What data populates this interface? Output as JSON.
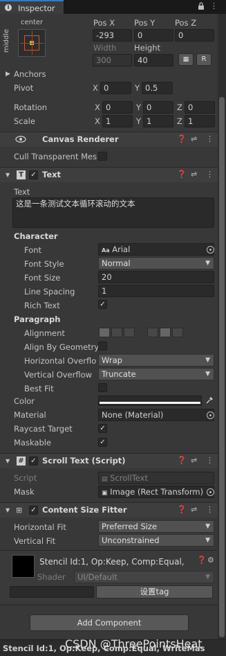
{
  "tab": {
    "title": "Inspector"
  },
  "rect_transform": {
    "anchor_preset": {
      "horizontal": "center",
      "vertical": "middle"
    },
    "pos_x_label": "Pos X",
    "pos_y_label": "Pos Y",
    "pos_z_label": "Pos Z",
    "pos_x": "-293",
    "pos_y": "0",
    "pos_z": "0",
    "width_label": "Width",
    "height_label": "Height",
    "width": "300",
    "height": "40",
    "r_button": "R",
    "anchors_label": "Anchors",
    "pivot_label": "Pivot",
    "pivot_x": "0",
    "pivot_y": "0.5",
    "rotation_label": "Rotation",
    "rot_x": "0",
    "rot_y": "0",
    "rot_z": "0",
    "scale_label": "Scale",
    "scale_x": "1",
    "scale_y": "1",
    "scale_z": "1",
    "axis_x": "X",
    "axis_y": "Y",
    "axis_z": "Z"
  },
  "canvas_renderer": {
    "title": "Canvas Renderer",
    "cull_label": "Cull Transparent Mes"
  },
  "text": {
    "title": "Text",
    "text_label": "Text",
    "text_value": "这是一条测试文本循环滚动的文本",
    "character_label": "Character",
    "font_label": "Font",
    "font_value": "Arial",
    "font_prefix": "Aa",
    "font_style_label": "Font Style",
    "font_style_value": "Normal",
    "font_size_label": "Font Size",
    "font_size_value": "20",
    "line_spacing_label": "Line Spacing",
    "line_spacing_value": "1",
    "rich_text_label": "Rich Text",
    "paragraph_label": "Paragraph",
    "alignment_label": "Alignment",
    "align_geometry_label": "Align By Geometry",
    "h_overflow_label": "Horizontal Overflow",
    "h_overflow_value": "Wrap",
    "v_overflow_label": "Vertical Overflow",
    "v_overflow_value": "Truncate",
    "best_fit_label": "Best Fit",
    "color_label": "Color",
    "color_value": "#ffffff",
    "material_label": "Material",
    "material_value": "None (Material)",
    "raycast_label": "Raycast Target",
    "maskable_label": "Maskable",
    "check": "✓"
  },
  "scroll_text": {
    "title": "Scroll Text (Script)",
    "script_label": "Script",
    "script_value": "ScrollText",
    "mask_label": "Mask",
    "mask_value": "Image (Rect Transform)"
  },
  "content_size_fitter": {
    "title": "Content Size Fitter",
    "h_fit_label": "Horizontal Fit",
    "h_fit_value": "Preferred Size",
    "v_fit_label": "Vertical Fit",
    "v_fit_value": "Unconstrained"
  },
  "material_preview": {
    "stencil_text": "Stencil Id:1, Op:Keep, Comp:Equal,",
    "shader_label": "Shader",
    "shader_value": "UI/Default",
    "set_tag_button": "设置tag"
  },
  "add_component_button": "Add Component",
  "status_bar": {
    "text": "Stencil Id:1, Op:Keep, Comp:Equal, WriteMas"
  },
  "watermark": "CSDN @ThreePointsHeat",
  "colors": {
    "accent": "#3a79bb",
    "panel": "#383838",
    "header": "#3e3e3e"
  }
}
